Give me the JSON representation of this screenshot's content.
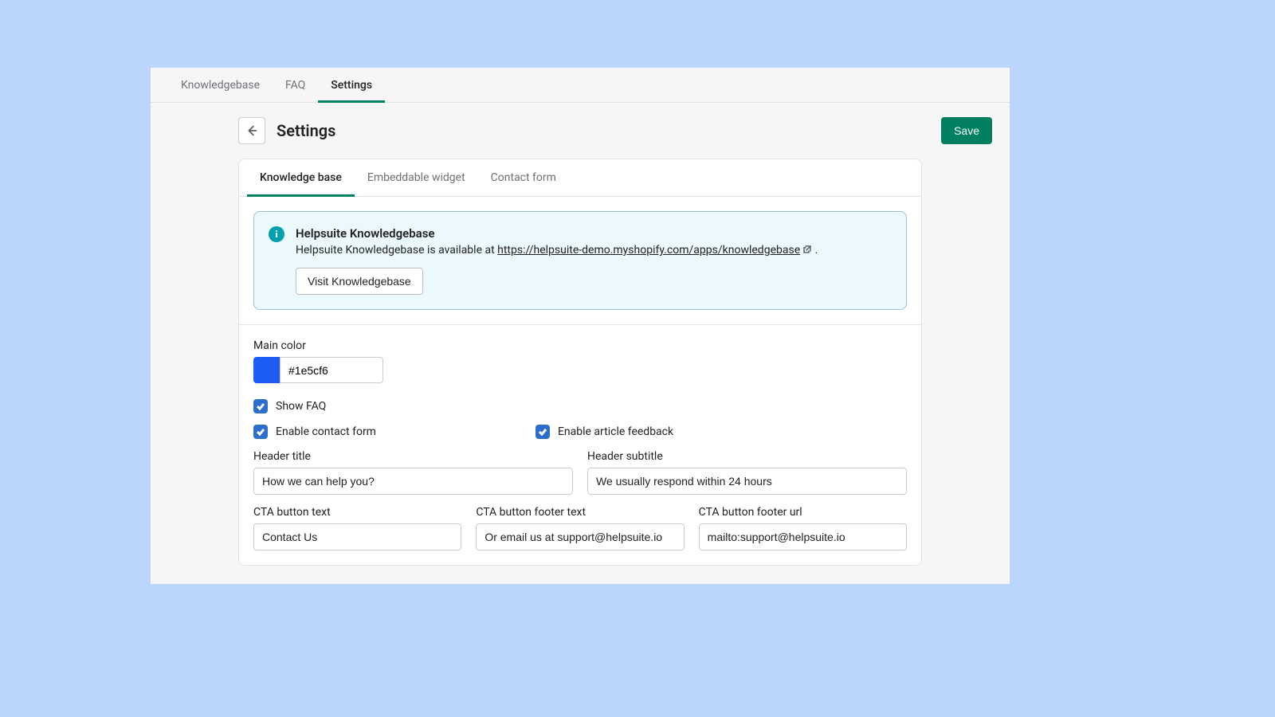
{
  "top_tabs": {
    "kb": "Knowledgebase",
    "faq": "FAQ",
    "settings": "Settings"
  },
  "header": {
    "title": "Settings",
    "save": "Save"
  },
  "sub_tabs": {
    "kb": "Knowledge base",
    "widget": "Embeddable widget",
    "contact": "Contact form"
  },
  "banner": {
    "title": "Helpsuite Knowledgebase",
    "text_prefix": "Helpsuite Knowledgebase is available at ",
    "link": "https://helpsuite-demo.myshopify.com/apps/knowledgebase",
    "text_suffix": " .",
    "visit": "Visit Knowledgebase"
  },
  "form": {
    "main_color_label": "Main color",
    "main_color_value": "#1e5cf6",
    "show_faq": "Show FAQ",
    "enable_contact": "Enable contact form",
    "enable_feedback": "Enable article feedback",
    "header_title_label": "Header title",
    "header_title_value": "How we can help you?",
    "header_subtitle_label": "Header subtitle",
    "header_subtitle_value": "We usually respond within 24 hours",
    "cta_text_label": "CTA button text",
    "cta_text_value": "Contact Us",
    "cta_footer_text_label": "CTA button footer text",
    "cta_footer_text_value": "Or email us at support@helpsuite.io",
    "cta_footer_url_label": "CTA button footer url",
    "cta_footer_url_value": "mailto:support@helpsuite.io"
  }
}
